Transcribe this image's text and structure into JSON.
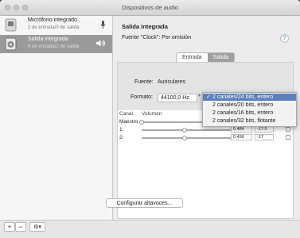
{
  "window": {
    "title": "Dispositivos de audio"
  },
  "sidebar": {
    "devices": [
      {
        "name": "Micrófono integrado",
        "subtitle": "2 de entrada/0 de salida",
        "extra": "mic-icon",
        "selected": false
      },
      {
        "name": "Salida integrada",
        "subtitle": "0 de entrada/2 de salida",
        "extra": "speaker-icon",
        "selected": true
      }
    ],
    "buttons": {
      "add": "+",
      "remove": "−",
      "gear": "⚙▾"
    }
  },
  "header": {
    "device_name": "Salida integrada",
    "source": "Fuente \"Clock\":  Por omisión",
    "help": "?"
  },
  "tabs": [
    {
      "label": "Entrada",
      "active": false
    },
    {
      "label": "Salida",
      "active": true
    }
  ],
  "settings": {
    "source_label": "Fuente:",
    "source_value": "Auriculares",
    "format_label": "Formato:",
    "format_value": "44100,0 Hz"
  },
  "format_menu": {
    "options": [
      {
        "label": "2 canales/24 bits, entero",
        "selected": true
      },
      {
        "label": "2 canales/20 bits, entero",
        "selected": false
      },
      {
        "label": "2 canales/16 bits, entero",
        "selected": false
      },
      {
        "label": "2 canales/32 bits, flotante",
        "selected": false
      }
    ],
    "check": "✓"
  },
  "channels": {
    "headers": {
      "channel": "Canal",
      "volume": "Volumen"
    },
    "rows": [
      {
        "label": "Maestro",
        "level": 0.0,
        "value": "",
        "db": ""
      },
      {
        "label": "1:",
        "level": 0.47,
        "value": "0.484",
        "db": "-17.5"
      },
      {
        "label": "2:",
        "level": 0.47,
        "value": "0.496",
        "db": "-17"
      }
    ]
  },
  "footer": {
    "configure_button": "Configurar altavoces..."
  },
  "colors": {
    "highlight": "#5b7fbf",
    "selected_row": "#9a9a9a"
  }
}
